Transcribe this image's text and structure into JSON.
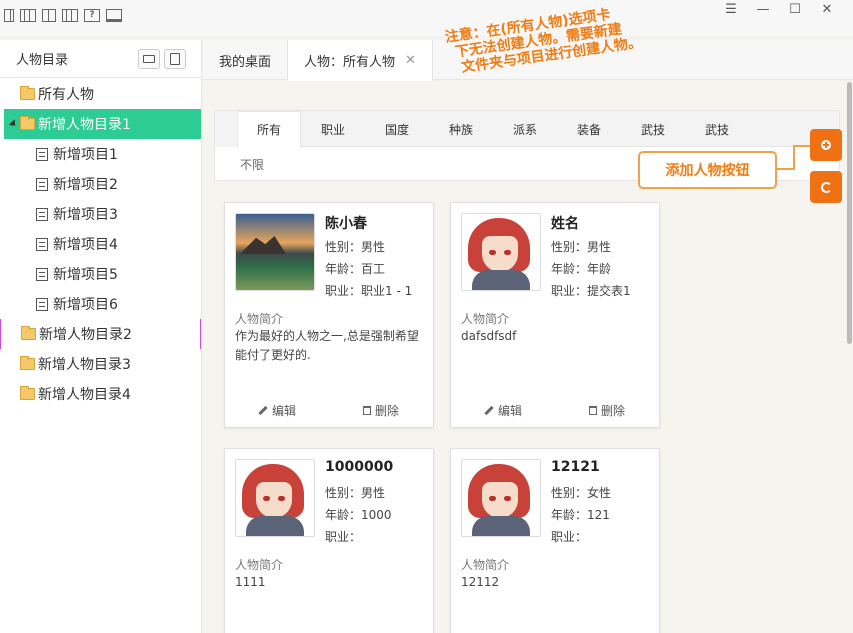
{
  "window": {
    "min": "☰",
    "restore": "—",
    "max": "☐",
    "close": "✕"
  },
  "sidebar": {
    "title": "人物目录",
    "items": [
      {
        "label": "所有人物"
      },
      {
        "label": "新增人物目录1"
      },
      {
        "label": "新增项目1"
      },
      {
        "label": "新增项目2"
      },
      {
        "label": "新增项目3"
      },
      {
        "label": "新增项目4"
      },
      {
        "label": "新增项目5"
      },
      {
        "label": "新增项目6"
      },
      {
        "label": "新增人物目录2"
      },
      {
        "label": "新增人物目录3"
      },
      {
        "label": "新增人物目录4"
      }
    ]
  },
  "tabs": [
    {
      "label": "我的桌面"
    },
    {
      "label": "人物：所有人物"
    }
  ],
  "filter": {
    "tabs": [
      "所有",
      "职业",
      "国度",
      "种族",
      "派系",
      "装备",
      "武技",
      "武技"
    ],
    "value": "不限"
  },
  "cards": [
    {
      "name": "陈小春",
      "gender": "性别：男性",
      "age": "年龄：百工",
      "job": "职业：职业1 - 1",
      "intro_label": "人物简介",
      "intro": "作为最好的人物之一,总是强制希望能付了更好的.",
      "edit": "编辑",
      "delete": "删除"
    },
    {
      "name": "姓名",
      "gender": "性别：男性",
      "age": "年龄：年龄",
      "job": "职业：提交表1",
      "intro_label": "人物简介",
      "intro": "dafsdfsdf",
      "edit": "编辑",
      "delete": "删除"
    },
    {
      "name": "1000000",
      "gender": "性别：男性",
      "age": "年龄：1000",
      "job": "职业：",
      "intro_label": "人物简介",
      "intro": "1111"
    },
    {
      "name": "12121",
      "gender": "性别：女性",
      "age": "年龄：121",
      "job": "职业：",
      "intro_label": "人物简介",
      "intro": "12112"
    }
  ],
  "annotation": {
    "lines": [
      "注意：在(所有人物)选项卡",
      "下无法创建人物。需要新建",
      "文件夹与项目进行创建人物。"
    ],
    "callout": "添加人物按钮"
  },
  "colors": {
    "accent": "#2dcc94",
    "orange": "#f07014"
  }
}
